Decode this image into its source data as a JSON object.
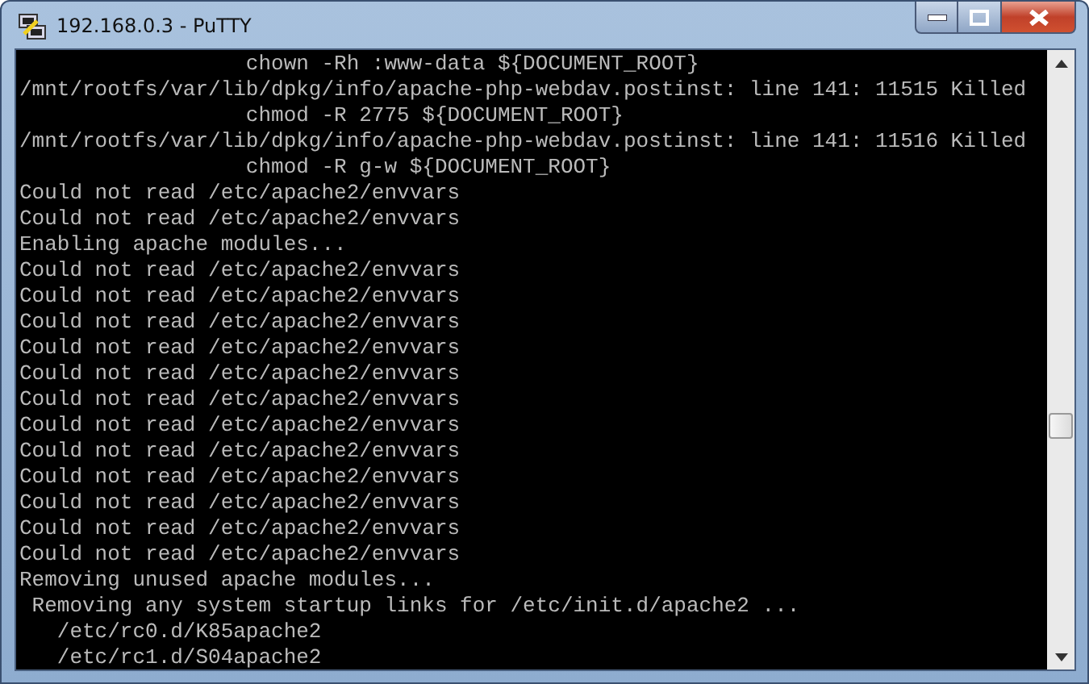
{
  "window": {
    "title": "192.168.0.3 - PuTTY"
  },
  "terminal": {
    "lines": [
      "                  chown -Rh :www-data ${DOCUMENT_ROOT}",
      "/mnt/rootfs/var/lib/dpkg/info/apache-php-webdav.postinst: line 141: 11515 Killed",
      "                  chmod -R 2775 ${DOCUMENT_ROOT}",
      "/mnt/rootfs/var/lib/dpkg/info/apache-php-webdav.postinst: line 141: 11516 Killed",
      "                  chmod -R g-w ${DOCUMENT_ROOT}",
      "Could not read /etc/apache2/envvars",
      "Could not read /etc/apache2/envvars",
      "Enabling apache modules...",
      "Could not read /etc/apache2/envvars",
      "Could not read /etc/apache2/envvars",
      "Could not read /etc/apache2/envvars",
      "Could not read /etc/apache2/envvars",
      "Could not read /etc/apache2/envvars",
      "Could not read /etc/apache2/envvars",
      "Could not read /etc/apache2/envvars",
      "Could not read /etc/apache2/envvars",
      "Could not read /etc/apache2/envvars",
      "Could not read /etc/apache2/envvars",
      "Could not read /etc/apache2/envvars",
      "Could not read /etc/apache2/envvars",
      "Removing unused apache modules...",
      " Removing any system startup links for /etc/init.d/apache2 ...",
      "   /etc/rc0.d/K85apache2",
      "   /etc/rc1.d/S04apache2"
    ]
  }
}
